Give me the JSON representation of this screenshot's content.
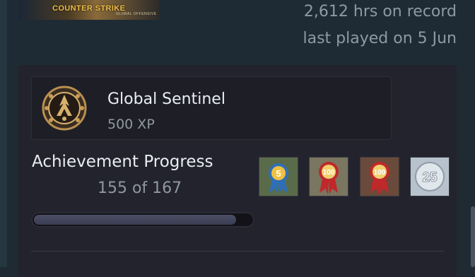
{
  "game": {
    "logo_title": "COUNTER STRIKE",
    "logo_subtitle": "GLOBAL OFFENSIVE",
    "hours_on_record": "2,612 hrs on record",
    "last_played": "last played on 5 Jun"
  },
  "badge": {
    "name": "Global Sentinel",
    "xp": "500 XP",
    "icon": "global-sentinel-badge-icon"
  },
  "achievements": {
    "label": "Achievement Progress",
    "count_text": "155 of 167",
    "unlocked": 155,
    "total": 167,
    "icons": [
      {
        "name": "achievement-5-ribbon-icon",
        "text": "5"
      },
      {
        "name": "achievement-100-ribbon-icon",
        "text": "100"
      },
      {
        "name": "achievement-100-ribbon-icon-2",
        "text": "100"
      },
      {
        "name": "achievement-25-icon",
        "text": "25"
      }
    ]
  },
  "colors": {
    "background": "#1f2a33",
    "panel": "#23232e",
    "progress_fill": "#44475c"
  }
}
